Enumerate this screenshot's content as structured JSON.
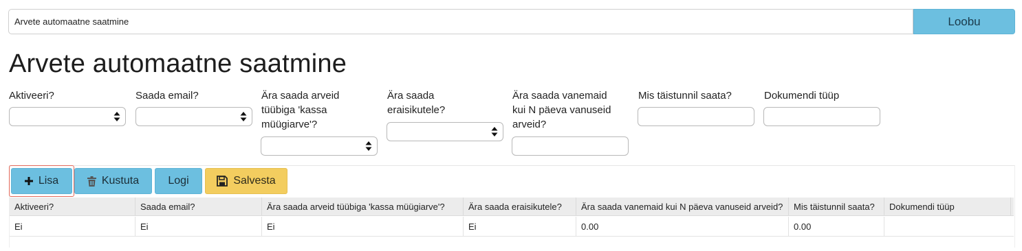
{
  "search": {
    "value": "Arvete automaatne saatmine"
  },
  "cancel_label": "Loobu",
  "page_title": "Arvete automaatne saatmine",
  "fields": {
    "activate": "Aktiveeri?",
    "send_email": "Saada email?",
    "skip_cash_line1": "Ära saada arveid",
    "skip_cash_line2": "tüübiga 'kassa",
    "skip_cash_line3": "müügiarve'?",
    "skip_private_line1": "Ära saada",
    "skip_private_line2": "eraisikutele?",
    "skip_old_line1": "Ära saada vanemaid",
    "skip_old_line2": "kui N päeva vanuseid",
    "skip_old_line3": "arveid?",
    "send_hour": "Mis täistunnil saata?",
    "doc_type": "Dokumendi tüüp"
  },
  "toolbar": {
    "add": "Lisa",
    "delete": "Kustuta",
    "log": "Logi",
    "save": "Salvesta"
  },
  "table": {
    "headers": [
      "Aktiveeri?",
      "Saada email?",
      "Ära saada arveid tüübiga 'kassa müügiarve'?",
      "Ära saada eraisikutele?",
      "Ära saada vanemaid kui N päeva vanuseid arveid?",
      "Mis täistunnil saata?",
      "Dokumendi tüüp"
    ],
    "rows": [
      [
        "Ei",
        "Ei",
        "Ei",
        "Ei",
        "0.00",
        "0.00",
        ""
      ]
    ]
  },
  "colors": {
    "accent_blue": "#6cbfe0",
    "accent_yellow": "#f3cd5f",
    "focus_outline": "#e2695a"
  }
}
